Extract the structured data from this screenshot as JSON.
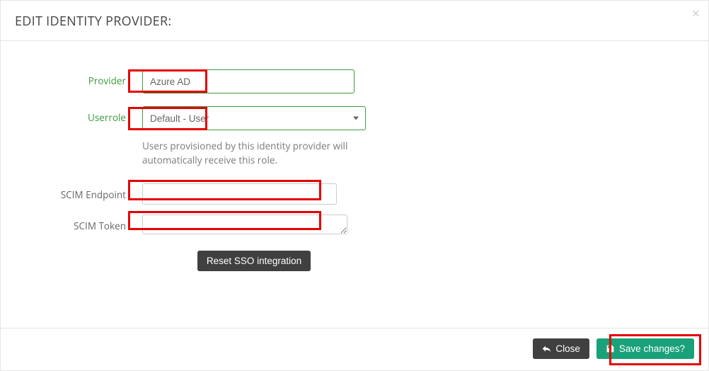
{
  "header": {
    "title": "EDIT IDENTITY PROVIDER:"
  },
  "fields": {
    "provider_label": "Provider",
    "provider_value": "Azure AD",
    "userrole_label": "Userrole",
    "userrole_selected": "Default - User",
    "userrole_help": "Users provisioned by this identity provider will automatically receive this role.",
    "scim_endpoint_label": "SCIM Endpoint",
    "scim_endpoint_value": "",
    "scim_token_label": "SCIM Token",
    "scim_token_value": ""
  },
  "buttons": {
    "reset": "Reset SSO integration",
    "close": "Close",
    "save": "Save changes?"
  }
}
